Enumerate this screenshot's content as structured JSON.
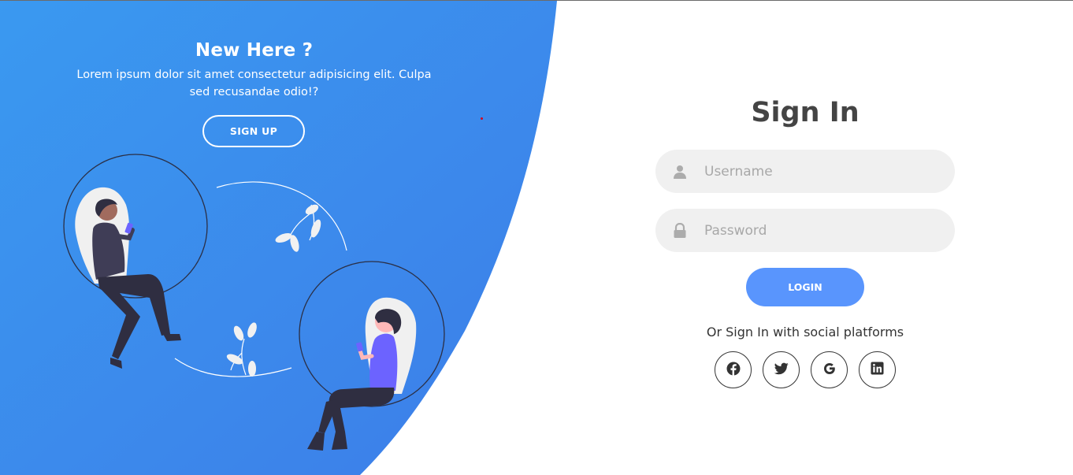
{
  "left_panel": {
    "title": "New Here ?",
    "description": "Lorem ipsum dolor sit amet consectetur adipisicing elit. Culpa sed recusandae odio!?",
    "signup_label": "SIGN UP"
  },
  "signin": {
    "title": "Sign In",
    "username_placeholder": "Username",
    "password_placeholder": "Password",
    "login_label": "LOGIN",
    "social_text": "Or Sign In with social platforms",
    "socials": [
      "facebook-icon",
      "twitter-icon",
      "google-icon",
      "linkedin-icon"
    ]
  },
  "colors": {
    "accent": "#5995fd",
    "panel_gradient_start": "#3a99f0",
    "panel_gradient_end": "#3d7de8",
    "title_text": "#444444"
  }
}
